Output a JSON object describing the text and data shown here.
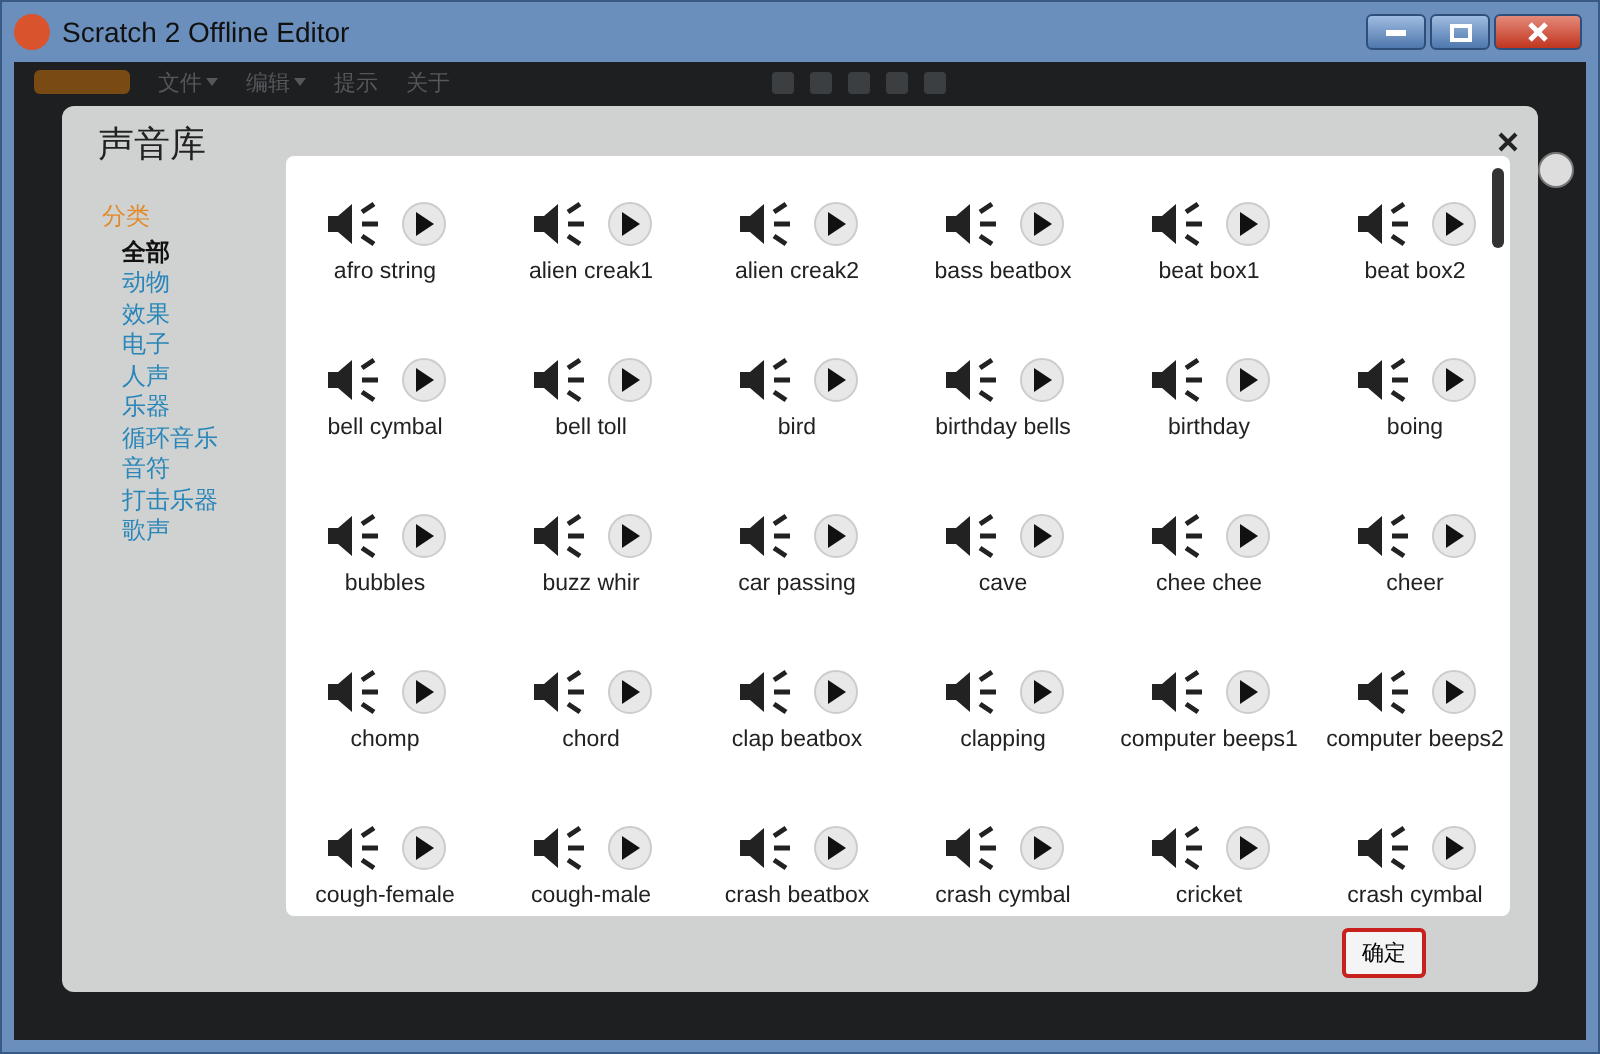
{
  "window": {
    "title": "Scratch 2 Offline Editor"
  },
  "menu": [
    {
      "label": "文件",
      "dropdown": true
    },
    {
      "label": "编辑",
      "dropdown": true
    },
    {
      "label": "提示",
      "dropdown": false
    },
    {
      "label": "关于",
      "dropdown": false
    }
  ],
  "dialog": {
    "title": "声音库",
    "category_heading": "分类",
    "categories": [
      {
        "label": "全部",
        "selected": true
      },
      {
        "label": "动物",
        "selected": false
      },
      {
        "label": "效果",
        "selected": false
      },
      {
        "label": "电子",
        "selected": false
      },
      {
        "label": "人声",
        "selected": false
      },
      {
        "label": "乐器",
        "selected": false
      },
      {
        "label": "循环音乐",
        "selected": false
      },
      {
        "label": "音符",
        "selected": false
      },
      {
        "label": "打击乐器",
        "selected": false
      },
      {
        "label": "歌声",
        "selected": false
      }
    ],
    "sounds": [
      {
        "name": "afro string"
      },
      {
        "name": "alien creak1"
      },
      {
        "name": "alien creak2"
      },
      {
        "name": "bass beatbox"
      },
      {
        "name": "beat box1"
      },
      {
        "name": "beat box2"
      },
      {
        "name": "bell cymbal"
      },
      {
        "name": "bell toll"
      },
      {
        "name": "bird"
      },
      {
        "name": "birthday bells"
      },
      {
        "name": "birthday"
      },
      {
        "name": "boing"
      },
      {
        "name": "bubbles"
      },
      {
        "name": "buzz whir"
      },
      {
        "name": "car passing"
      },
      {
        "name": "cave"
      },
      {
        "name": "chee chee"
      },
      {
        "name": "cheer"
      },
      {
        "name": "chomp"
      },
      {
        "name": "chord"
      },
      {
        "name": "clap beatbox"
      },
      {
        "name": "clapping"
      },
      {
        "name": "computer beeps1"
      },
      {
        "name": "computer beeps2"
      },
      {
        "name": "cough-female"
      },
      {
        "name": "cough-male"
      },
      {
        "name": "crash beatbox"
      },
      {
        "name": "crash cymbal"
      },
      {
        "name": "cricket"
      },
      {
        "name": "crash cymbal"
      }
    ],
    "ok_button": "确定"
  }
}
